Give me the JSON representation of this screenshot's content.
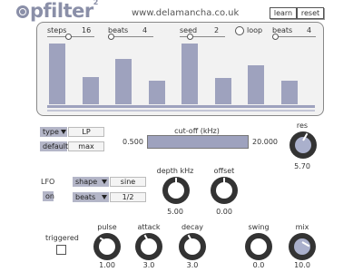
{
  "header": {
    "title": "pfilter",
    "superscript": "2",
    "url": "www.delamancha.co.uk",
    "learn_label": "learn",
    "reset_label": "reset"
  },
  "sequencer": {
    "steps_label": "steps",
    "steps_value": "16",
    "beats_label": "beats",
    "beats_value": "4",
    "seed_label": "seed",
    "seed_value": "2",
    "loop_label": "loop",
    "beats2_label": "beats",
    "beats2_value": "4",
    "bar_levels": [
      0.88,
      0.4,
      0.66,
      0.34,
      0.88,
      0.38,
      0.56,
      0.34
    ]
  },
  "filter": {
    "type_label": "type",
    "type_value": "LP",
    "default_label": "default",
    "default_value": "max",
    "cutoff_label": "cut-off (kHz)",
    "cutoff_min": "0.500",
    "cutoff_max": "20.000",
    "res_label": "res",
    "res_value": "5.70"
  },
  "lfo": {
    "label": "LFO",
    "on_label": "on",
    "shape_label": "shape",
    "shape_value": "sine",
    "beats_label": "beats",
    "beats_value": "1/2",
    "depth_label": "depth kHz",
    "depth_value": "5.00",
    "offset_label": "offset",
    "offset_value": "0.00"
  },
  "envelope": {
    "triggered_label": "triggered",
    "pulse_label": "pulse",
    "pulse_value": "1.00",
    "attack_label": "attack",
    "attack_value": "3.0",
    "decay_label": "decay",
    "decay_value": "3.0",
    "swing_label": "swing",
    "swing_value": "0.0",
    "mix_label": "mix",
    "mix_value": "10.0"
  },
  "colors": {
    "accent": "#9ea2be",
    "panel": "#f2f2f2",
    "knob_dark": "#333333"
  }
}
